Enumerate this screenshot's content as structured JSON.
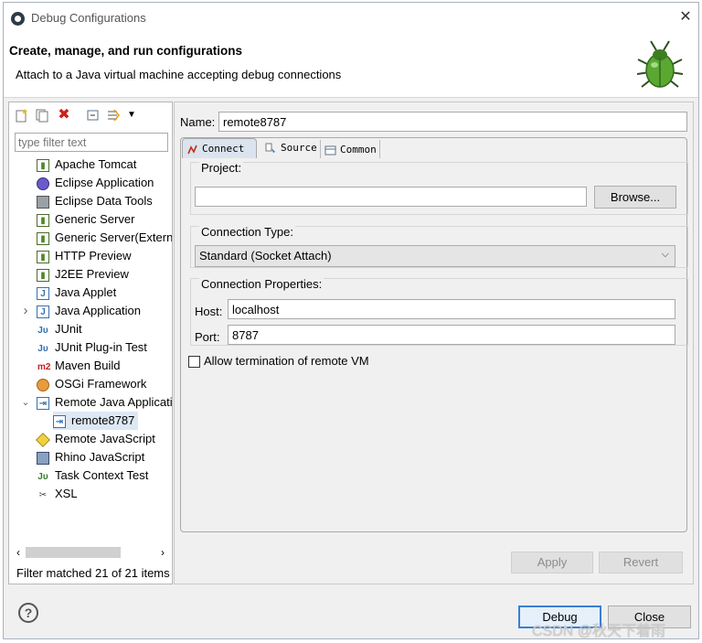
{
  "window": {
    "title": "Debug Configurations"
  },
  "banner": {
    "title": "Create, manage, and run configurations",
    "subtitle": "Attach to a Java virtual machine accepting debug connections"
  },
  "left_panel": {
    "filter_placeholder": "type filter text",
    "tree": [
      {
        "label": "Apache Tomcat",
        "icon": "server-icon",
        "depth": 0
      },
      {
        "label": "Eclipse Application",
        "icon": "eclipse-icon",
        "depth": 0
      },
      {
        "label": "Eclipse Data Tools",
        "icon": "database-icon",
        "depth": 0
      },
      {
        "label": "Generic Server",
        "icon": "server-icon",
        "depth": 0
      },
      {
        "label": "Generic Server(Externa",
        "icon": "server-icon",
        "depth": 0
      },
      {
        "label": "HTTP Preview",
        "icon": "server-icon",
        "depth": 0
      },
      {
        "label": "J2EE Preview",
        "icon": "server-icon",
        "depth": 0
      },
      {
        "label": "Java Applet",
        "icon": "applet-icon",
        "depth": 0
      },
      {
        "label": "Java Application",
        "icon": "java-app-icon",
        "depth": 0,
        "twisty": "collapsed"
      },
      {
        "label": "JUnit",
        "icon": "junit-icon",
        "depth": 0
      },
      {
        "label": "JUnit Plug-in Test",
        "icon": "junit-plugin-icon",
        "depth": 0
      },
      {
        "label": "Maven Build",
        "icon": "maven-icon",
        "depth": 0
      },
      {
        "label": "OSGi Framework",
        "icon": "osgi-icon",
        "depth": 0
      },
      {
        "label": "Remote Java Applicati",
        "icon": "remote-java-icon",
        "depth": 0,
        "twisty": "expanded"
      },
      {
        "label": "remote8787",
        "icon": "remote-java-icon",
        "depth": 1,
        "selected": true
      },
      {
        "label": "Remote JavaScript",
        "icon": "remote-js-icon",
        "depth": 0
      },
      {
        "label": "Rhino JavaScript",
        "icon": "rhino-icon",
        "depth": 0
      },
      {
        "label": "Task Context Test",
        "icon": "task-test-icon",
        "depth": 0
      },
      {
        "label": "XSL",
        "icon": "xsl-icon",
        "depth": 0
      }
    ],
    "filter_status": "Filter matched 21 of 21 items"
  },
  "right_panel": {
    "name_label": "Name:",
    "name_value": "remote8787",
    "tabs": [
      {
        "label": "Connect",
        "icon": "connect-icon",
        "active": true
      },
      {
        "label": "Source",
        "icon": "source-icon",
        "active": false
      },
      {
        "label": "Common",
        "icon": "common-icon",
        "active": false
      }
    ],
    "project": {
      "label": "Project:",
      "value": "",
      "browse_label": "Browse..."
    },
    "connection_type": {
      "label": "Connection Type:",
      "selected": "Standard (Socket Attach)"
    },
    "connection_properties": {
      "label": "Connection Properties:",
      "host_label": "Host:",
      "host_value": "localhost",
      "port_label": "Port:",
      "port_value": "8787"
    },
    "allow_termination": {
      "label": "Allow termination of remote VM",
      "checked": false
    },
    "apply_label": "Apply",
    "revert_label": "Revert"
  },
  "footer": {
    "debug_label": "Debug",
    "close_label": "Close"
  },
  "watermark": "CSDN @秋天下着雨",
  "colors": {
    "window_bg": "#f0f0f0",
    "selection_bg": "#dde8f4",
    "default_button_border": "#3a7fd5"
  }
}
